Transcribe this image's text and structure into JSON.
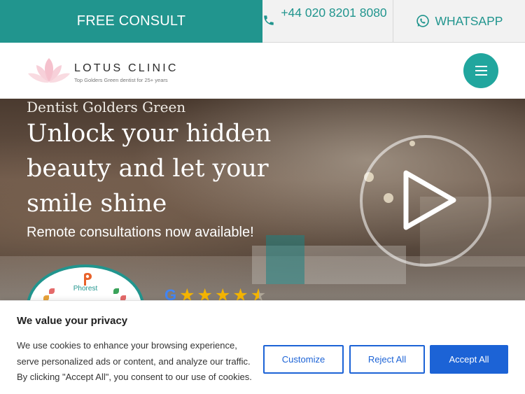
{
  "topbar": {
    "consult_label": "FREE CONSULT",
    "phone_number": "+44 020 8201 8080",
    "whatsapp_label": "WHATSAPP"
  },
  "header": {
    "brand": "LOTUS CLINIC",
    "tagline": "Top Golders Green dentist for 25+ years"
  },
  "hero": {
    "subtitle": "Dentist Golders Green",
    "headline": "Unlock your hidden beauty and let your smile shine",
    "remote_note": "Remote consultations now available!",
    "badge_label": "Phorest",
    "google_letter": "G",
    "rating_stars": 4.5
  },
  "cookie": {
    "title": "We value your privacy",
    "body": "We use cookies to enhance your browsing experience, serve personalized ads or content, and analyze our traffic. By clicking \"Accept All\", you consent to our use of cookies.",
    "customize_label": "Customize",
    "reject_label": "Reject All",
    "accept_label": "Accept All"
  },
  "colors": {
    "teal": "#21958e",
    "menu_teal": "#21a69e",
    "accent_blue": "#1c63d6",
    "star_gold": "#f4b400"
  },
  "icons": [
    "phone-icon",
    "whatsapp-icon",
    "lotus-logo-icon",
    "hamburger-icon",
    "play-icon",
    "phorest-icon",
    "google-icon",
    "star-icon"
  ]
}
